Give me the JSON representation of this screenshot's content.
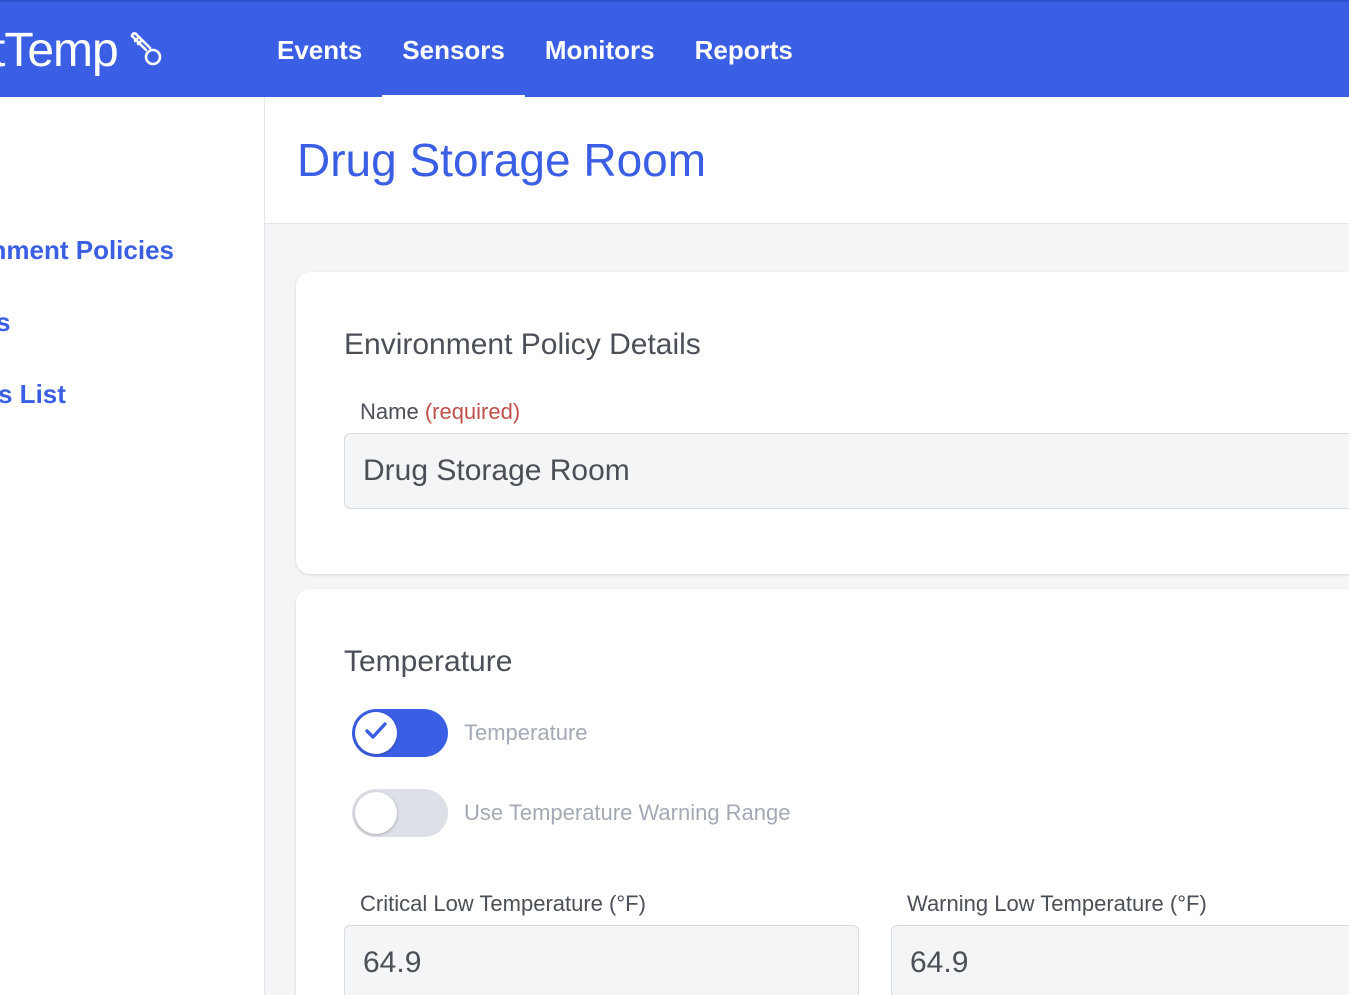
{
  "header": {
    "logo_text": "tTemp",
    "logo_icon": "thermometer-icon",
    "nav": [
      {
        "label": "Events",
        "active": false
      },
      {
        "label": "Sensors",
        "active": true
      },
      {
        "label": "Monitors",
        "active": false
      },
      {
        "label": "Reports",
        "active": false
      }
    ]
  },
  "sidebar": {
    "items": [
      {
        "label": "nment Policies"
      },
      {
        "label": "s"
      },
      {
        "label": "s List"
      }
    ]
  },
  "page": {
    "title": "Drug Storage Room"
  },
  "policy_details": {
    "section_title": "Environment Policy Details",
    "name_label": "Name",
    "name_required": "(required)",
    "name_value": "Drug Storage Room"
  },
  "temperature": {
    "section_title": "Temperature",
    "toggle_temperature": {
      "label": "Temperature",
      "on": true
    },
    "toggle_warning_range": {
      "label": "Use Temperature Warning Range",
      "on": false
    },
    "critical_low_label": "Critical Low Temperature (°F)",
    "critical_low_value": "64.9",
    "warning_low_label": "Warning Low Temperature (°F)",
    "warning_low_value": "64.9"
  },
  "colors": {
    "brand": "#3b5fe4",
    "required": "#c0504d"
  }
}
